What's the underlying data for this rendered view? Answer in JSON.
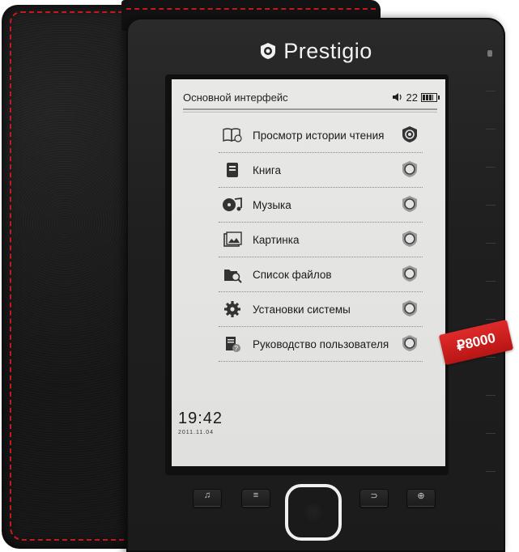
{
  "device": {
    "brand": "Prestigio"
  },
  "screen": {
    "header_title": "Основной интерфейс",
    "volume_icon": "speaker-icon",
    "volume_level": "22",
    "battery_icon": "battery-icon"
  },
  "menu": {
    "items": [
      {
        "label": "Просмотр истории чтения",
        "icon": "history-book-icon",
        "selected": true
      },
      {
        "label": "Книга",
        "icon": "book-icon",
        "selected": false
      },
      {
        "label": "Музыка",
        "icon": "music-icon",
        "selected": false
      },
      {
        "label": "Картинка",
        "icon": "picture-icon",
        "selected": false
      },
      {
        "label": "Список файлов",
        "icon": "file-list-icon",
        "selected": false
      },
      {
        "label": "Установки системы",
        "icon": "gear-icon",
        "selected": false
      },
      {
        "label": "Руководство пользователя",
        "icon": "help-document-icon",
        "selected": false
      }
    ]
  },
  "clock": {
    "time": "19:42",
    "date": "2011.11.04"
  },
  "buttons": {
    "music": "♫",
    "menu": "≡",
    "back": "⊃",
    "zoom": "⊕"
  },
  "price_tag": "₽8000",
  "colors": {
    "accent_red": "#c4191f",
    "device_body": "#1f1f1f",
    "eink_bg": "#e4e4e2"
  }
}
